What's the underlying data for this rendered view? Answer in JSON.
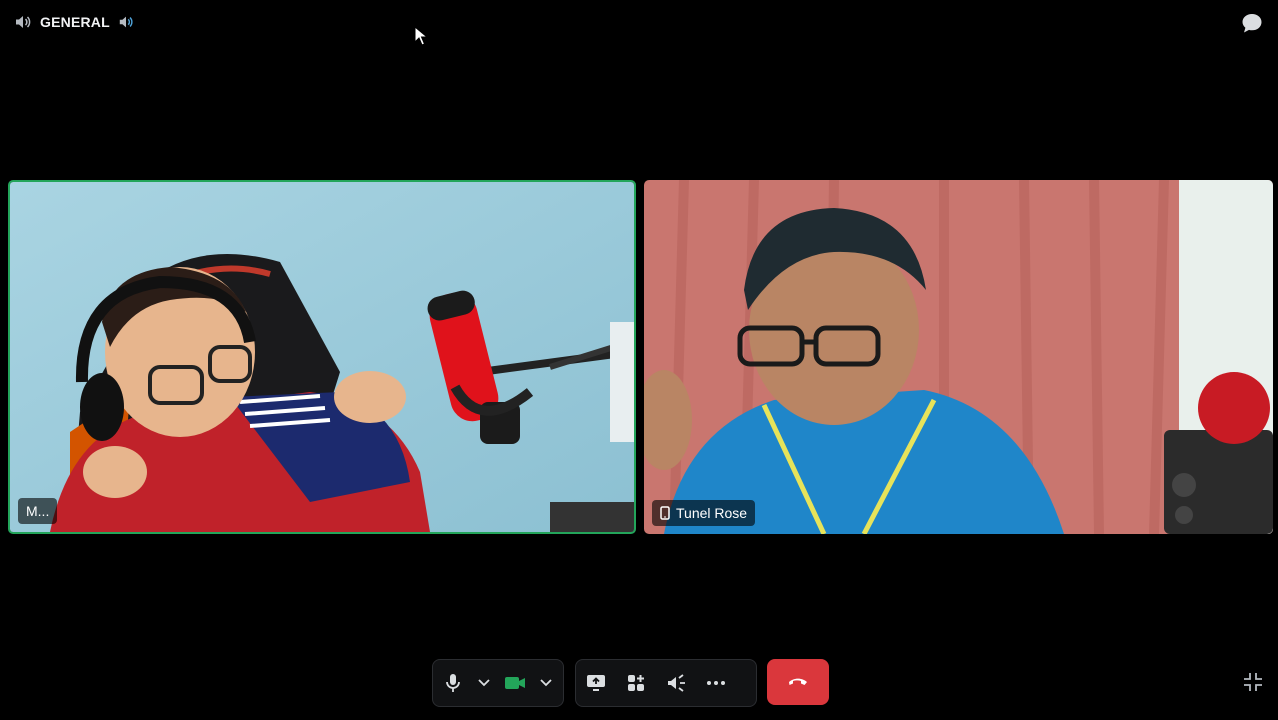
{
  "header": {
    "channel_name": "GENERAL",
    "icons": [
      "speaker-icon",
      "volume-icon",
      "chat-bubble-icon"
    ]
  },
  "participants": [
    {
      "name": "M...",
      "speaking": true,
      "device": ""
    },
    {
      "name": "Tunel Rose",
      "speaking": false,
      "device": "mobile-icon"
    }
  ],
  "controls": {
    "icons": [
      "microphone-icon",
      "chevron-down-icon",
      "camera-icon",
      "chevron-down-icon",
      "screen-share-icon",
      "activities-icon",
      "soundboard-icon",
      "more-icon",
      "hang-up-icon",
      "exit-fullscreen-icon"
    ]
  },
  "colors": {
    "background": "#000000",
    "speaking_border": "#23a55a",
    "hangup": "#da373c",
    "camera_active": "#23a55a",
    "control_bar": "#111214"
  }
}
